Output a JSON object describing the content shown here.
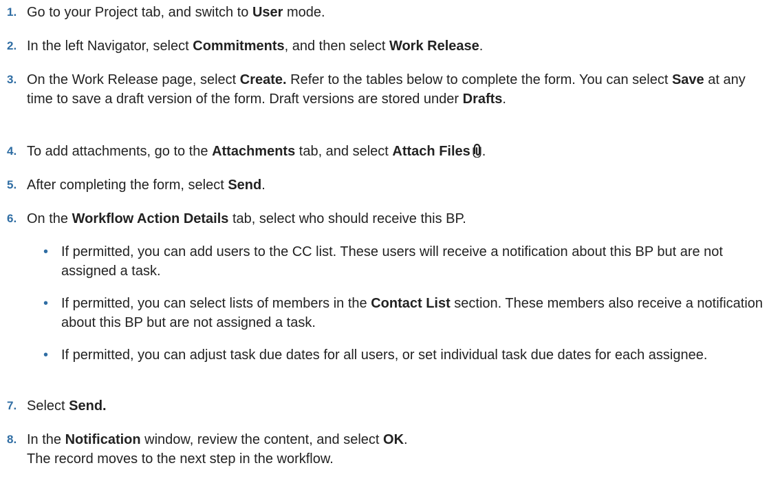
{
  "steps": [
    {
      "number": "1.",
      "parts": [
        "Go to your Project tab, and switch to ",
        "User",
        " mode."
      ]
    },
    {
      "number": "2.",
      "parts": [
        "In the left Navigator, select ",
        "Commitments",
        ", and then select ",
        "Work Release",
        "."
      ]
    },
    {
      "number": "3.",
      "parts": [
        "On the Work Release page, select ",
        "Create.",
        " Refer to the tables below to complete the form. You can select ",
        "Save",
        " at any time to save a draft version of the form. Draft versions are stored under ",
        "Drafts",
        "."
      ]
    },
    {
      "number": "4.",
      "parts": [
        "To add attachments, go to the ",
        "Attachments",
        " tab, and select ",
        "Attach Files",
        "."
      ]
    },
    {
      "number": "5.",
      "parts": [
        "After completing the form, select ",
        "Send",
        "."
      ]
    },
    {
      "number": "6.",
      "parts": [
        "On the ",
        "Workflow Action Details",
        " tab, select who should receive this BP."
      ]
    },
    {
      "number": "7.",
      "parts": [
        "Select ",
        "Send."
      ]
    },
    {
      "number": "8.",
      "parts": [
        "In the ",
        "Notification",
        " window, review the content, and select ",
        "OK",
        "."
      ],
      "line2": "The record moves to the next step in the workflow."
    }
  ],
  "bullets": [
    {
      "parts": [
        "If permitted, you can add users to the CC list. These users will receive a notification about this BP but are not assigned a task."
      ]
    },
    {
      "parts": [
        "If permitted, you can select lists of members in the ",
        "Contact List",
        " section. These members also receive a notification about this BP but are not assigned a task."
      ]
    },
    {
      "parts": [
        "If permitted, you can adjust task due dates for all users, or set individual task due dates for each assignee."
      ]
    }
  ],
  "bullet_symbol": "•",
  "icons": {
    "attach": "paperclip-icon"
  },
  "colors": {
    "accent": "#2f6da3",
    "text": "#222222"
  }
}
